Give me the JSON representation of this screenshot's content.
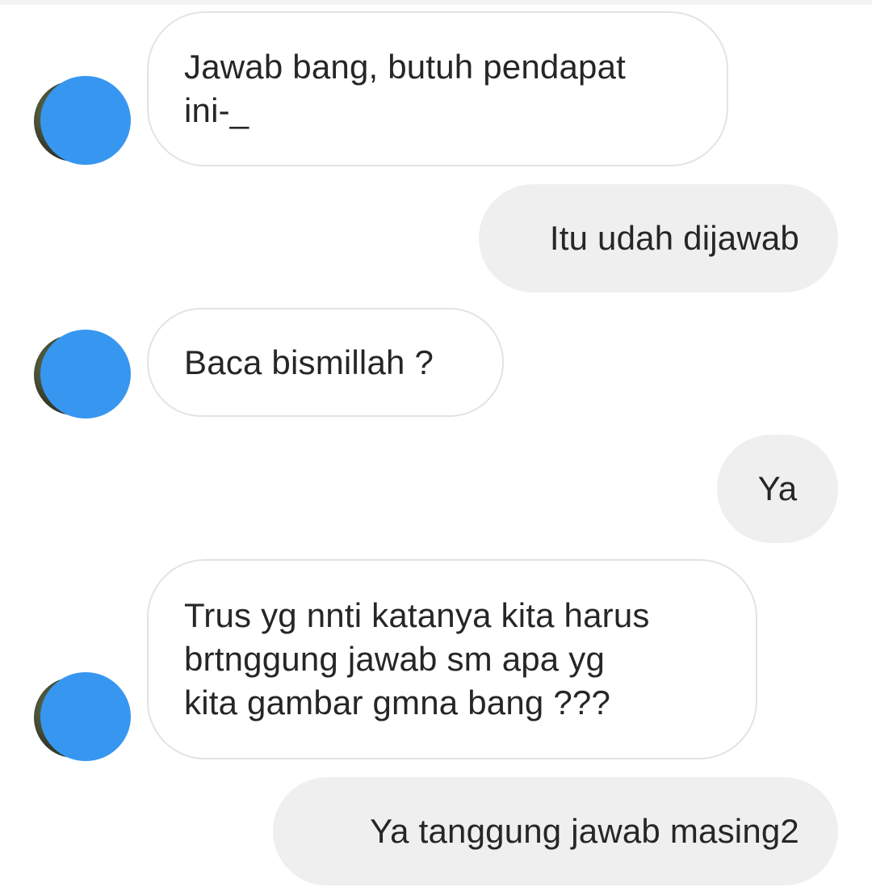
{
  "chat": {
    "messages": [
      {
        "side": "received",
        "text": "Jawab bang, butuh pendapat\nini-_"
      },
      {
        "side": "sent",
        "text": "Itu udah dijawab"
      },
      {
        "side": "received",
        "text": "Baca bismillah ?"
      },
      {
        "side": "sent",
        "text": "Ya"
      },
      {
        "side": "received",
        "text": "Trus yg nnti katanya kita harus\nbrtnggung jawab sm apa yg\nkita gambar gmna bang ???"
      },
      {
        "side": "sent",
        "text": "Ya tanggung jawab masing2"
      }
    ],
    "avatar_icon": "profile-avatar-redacted",
    "colors": {
      "received_bubble": "#ffffff",
      "received_border": "#e3e3e3",
      "sent_bubble": "#efefef",
      "avatar_redaction": "#3797f0",
      "text": "#262626"
    }
  }
}
